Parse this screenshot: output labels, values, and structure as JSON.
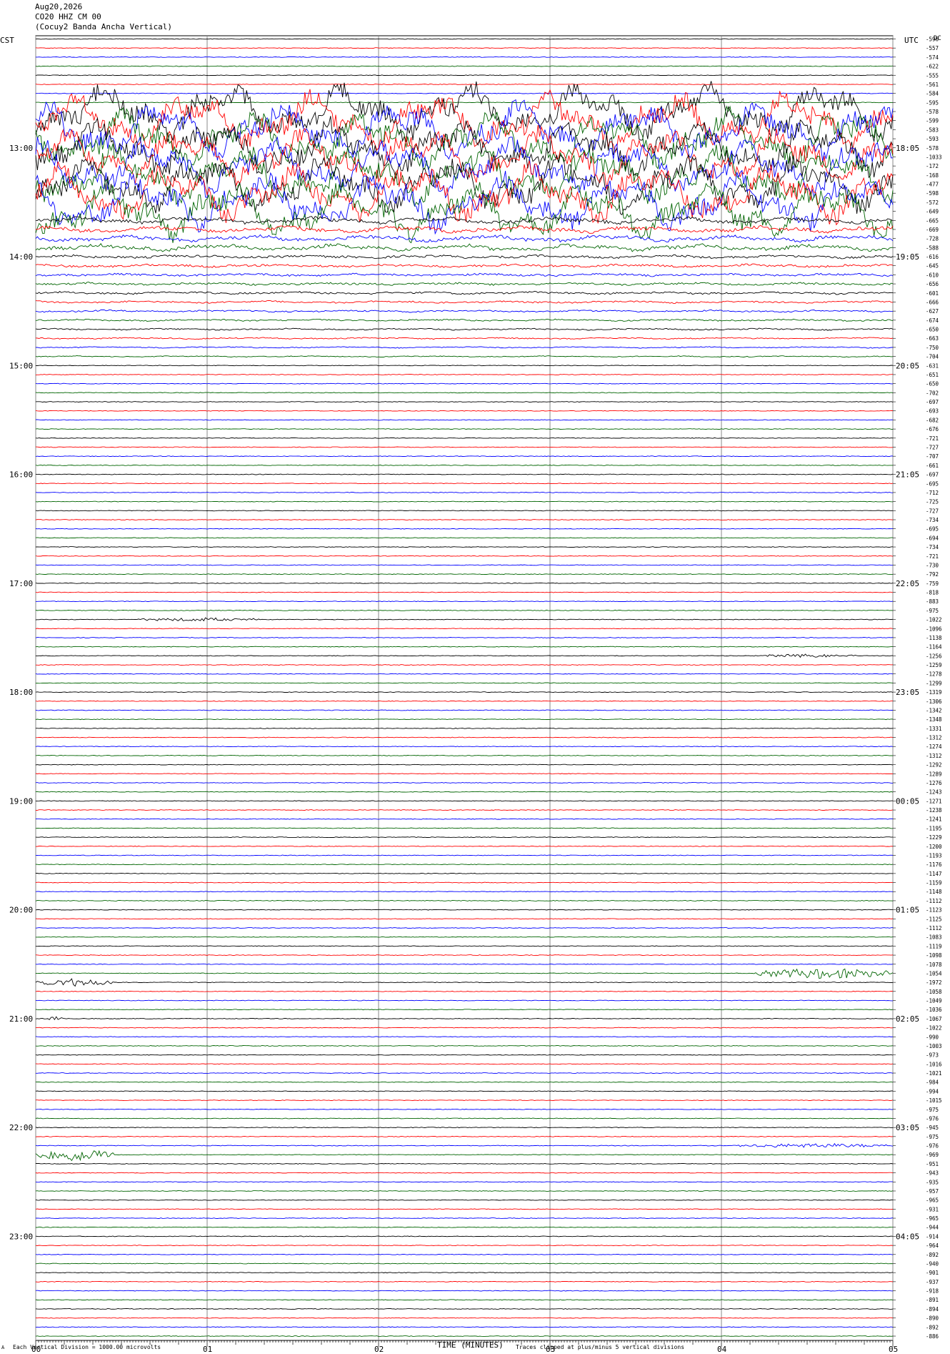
{
  "header": {
    "date": "Aug20,2026",
    "station": "CO20 HHZ CM 00",
    "name": "(Cocuy2 Banda Ancha Vertical)"
  },
  "left_tz": "CST",
  "right_tz": "UTC",
  "dc_label": "DC",
  "footer": {
    "scale_note": "Each Vertical Division = 1000.00 microvolts",
    "clip_note": "Traces clipped at plus/minus 5 vertical divisions",
    "mark": "A"
  },
  "chart_data": {
    "type": "line",
    "xlabel": "TIME (MINUTES)",
    "xlim": [
      0,
      5
    ],
    "x_ticks": [
      "00",
      "01",
      "02",
      "03",
      "04",
      "05"
    ],
    "trace_count": 144,
    "trace_colors": [
      "#000000",
      "#ff0000",
      "#0000ff",
      "#006400"
    ],
    "left_hour_labels": [
      "13:00",
      "14:00",
      "15:00",
      "16:00",
      "17:00",
      "18:00",
      "19:00",
      "20:00",
      "21:00",
      "22:00",
      "23:00"
    ],
    "left_hour_rows": [
      12,
      24,
      36,
      48,
      60,
      72,
      84,
      96,
      108,
      120,
      132
    ],
    "right_hour_labels": [
      "18:05",
      "19:05",
      "20:05",
      "21:05",
      "22:05",
      "23:05",
      "00:05",
      "01:05",
      "02:05",
      "03:05",
      "04:05"
    ],
    "dc_offsets": [
      -596,
      -557,
      -574,
      -622,
      -555,
      -561,
      -584,
      -595,
      -578,
      -599,
      -583,
      -593,
      -578,
      -1033,
      -172,
      -168,
      -477,
      -598,
      -572,
      -649,
      -665,
      -669,
      -728,
      -588,
      -616,
      -645,
      -610,
      -656,
      -601,
      -666,
      -627,
      -674,
      -650,
      -663,
      -750,
      -704,
      -631,
      -651,
      -650,
      -702,
      -697,
      -693,
      -682,
      -676,
      -721,
      -727,
      -707,
      -661,
      -697,
      -695,
      -712,
      -725,
      -727,
      -734,
      -695,
      -694,
      -734,
      -721,
      -730,
      -792,
      -759,
      -818,
      -883,
      -975,
      -1022,
      -1096,
      -1138,
      -1164,
      -1256,
      -1259,
      -1278,
      -1299,
      -1319,
      -1306,
      -1342,
      -1348,
      -1331,
      -1312,
      -1274,
      -1312,
      -1292,
      -1289,
      -1276,
      -1243,
      -1271,
      -1238,
      -1241,
      -1195,
      -1229,
      -1200,
      -1193,
      -1176,
      -1147,
      -1159,
      -1148,
      -1112,
      -1123,
      -1125,
      -1112,
      -1083,
      -1119,
      -1098,
      -1078,
      -1054,
      -1972,
      -1058,
      -1049,
      -1036,
      -1067,
      -1022,
      -990,
      -1003,
      -973,
      -1016,
      -1021,
      -984,
      -994,
      -1015,
      -975,
      -976,
      -945,
      -975,
      -976,
      -969,
      -951,
      -943,
      -935,
      -957,
      -965,
      -931,
      -965,
      -944,
      -914,
      -964,
      -892,
      -940,
      -901,
      -937,
      -918,
      -891,
      -894,
      -890,
      -892,
      -886
    ],
    "event_segments": [
      {
        "trace": 104,
        "x_start": 0.0,
        "x_end": 0.45,
        "intensity": 3
      },
      {
        "trace": 103,
        "x_start": 4.2,
        "x_end": 5.0,
        "intensity": 4
      },
      {
        "trace": 108,
        "x_start": 0.08,
        "x_end": 0.16,
        "intensity": 2
      },
      {
        "trace": 122,
        "x_start": 4.1,
        "x_end": 5.0,
        "intensity": 1.5
      },
      {
        "trace": 123,
        "x_start": 0.0,
        "x_end": 0.45,
        "intensity": 5
      },
      {
        "trace": 64,
        "x_start": 0.6,
        "x_end": 1.3,
        "intensity": 1.2
      },
      {
        "trace": 68,
        "x_start": 4.2,
        "x_end": 4.8,
        "intensity": 1.2
      }
    ]
  }
}
